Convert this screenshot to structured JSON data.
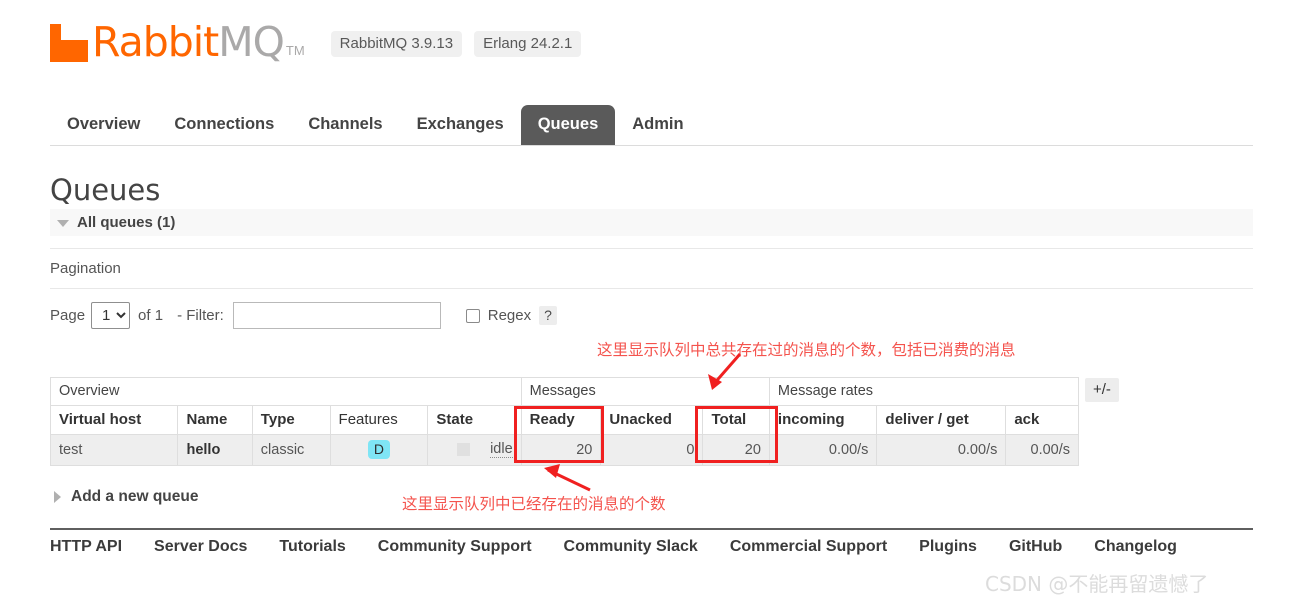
{
  "branding": {
    "logo_rabbit": "Rabbit",
    "logo_mq": "MQ",
    "logo_tm": "TM",
    "server_version": "RabbitMQ 3.9.13",
    "erlang_version": "Erlang 24.2.1"
  },
  "nav": {
    "items": [
      {
        "label": "Overview",
        "active": false
      },
      {
        "label": "Connections",
        "active": false
      },
      {
        "label": "Channels",
        "active": false
      },
      {
        "label": "Exchanges",
        "active": false
      },
      {
        "label": "Queues",
        "active": true
      },
      {
        "label": "Admin",
        "active": false
      }
    ]
  },
  "page": {
    "title": "Queues",
    "section_header": "All queues (1)",
    "pagination_label": "Pagination",
    "add_queue_label": "Add a new queue"
  },
  "pager": {
    "page_word": "Page",
    "page_value": "1",
    "page_options": [
      "1"
    ],
    "of_text": "of 1",
    "filter_label": "- Filter:",
    "filter_value": "",
    "filter_placeholder": "",
    "regex_label": "Regex",
    "help_label": "?"
  },
  "table": {
    "groups": [
      {
        "label": "Overview",
        "span": 5
      },
      {
        "label": "Messages",
        "span": 3
      },
      {
        "label": "Message rates",
        "span": 3
      }
    ],
    "columns": [
      {
        "label": "Virtual host",
        "bold": true,
        "align": "l"
      },
      {
        "label": "Name",
        "bold": true,
        "align": "l"
      },
      {
        "label": "Type",
        "bold": true,
        "align": "l"
      },
      {
        "label": "Features",
        "bold": false,
        "align": "l"
      },
      {
        "label": "State",
        "bold": true,
        "align": "l"
      },
      {
        "label": "Ready",
        "bold": true,
        "align": "l"
      },
      {
        "label": "Unacked",
        "bold": true,
        "align": "l"
      },
      {
        "label": "Total",
        "bold": true,
        "align": "l"
      },
      {
        "label": "incoming",
        "bold": true,
        "align": "l"
      },
      {
        "label": "deliver / get",
        "bold": true,
        "align": "l"
      },
      {
        "label": "ack",
        "bold": true,
        "align": "l"
      }
    ],
    "rows": [
      {
        "virtual_host": "test",
        "name": "hello",
        "type": "classic",
        "features": "D",
        "state": "idle",
        "ready": "20",
        "unacked": "0",
        "total": "20",
        "incoming": "0.00/s",
        "deliver_get": "0.00/s",
        "ack": "0.00/s"
      }
    ],
    "toggle_columns_label": "+/-"
  },
  "annotations": {
    "total_note": "这里显示队列中总共存在过的消息的个数，包括已消费的消息",
    "ready_note": "这里显示队列中已经存在的消息的个数",
    "highlight_color": "#f02020"
  },
  "footer": {
    "links": [
      "HTTP API",
      "Server Docs",
      "Tutorials",
      "Community Support",
      "Community Slack",
      "Commercial Support",
      "Plugins",
      "GitHub",
      "Changelog"
    ]
  },
  "watermark": {
    "text": "CSDN @不能再留遗憾了"
  }
}
